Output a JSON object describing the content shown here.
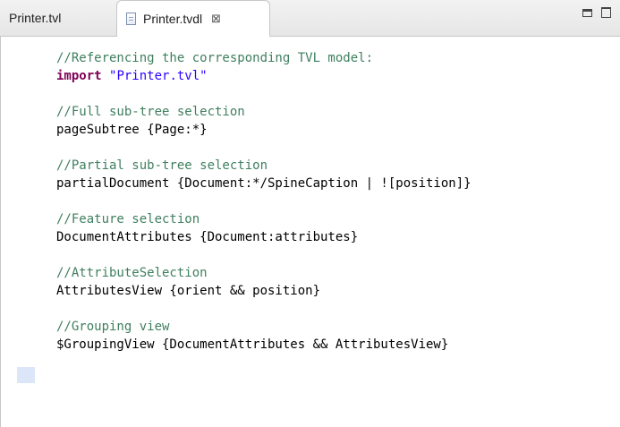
{
  "tabs": [
    {
      "label": "Printer.tvl",
      "active": false
    },
    {
      "label": "Printer.tvdl",
      "active": true,
      "icon": "file-icon",
      "close_glyph": "⊠"
    }
  ],
  "window_controls": {
    "minimize": "minimize-icon",
    "maximize": "maximize-icon"
  },
  "code_lines": [
    {
      "comment": "//Referencing the corresponding TVL model:"
    },
    {
      "keyword": "import",
      "string": "\"Printer.tvl\""
    },
    {
      "blank": true
    },
    {
      "comment": "//Full sub-tree selection"
    },
    {
      "plain": "pageSubtree {Page:*}"
    },
    {
      "blank": true
    },
    {
      "comment": "//Partial sub-tree selection"
    },
    {
      "plain": "partialDocument {Document:*/SpineCaption | ![position]}"
    },
    {
      "blank": true
    },
    {
      "comment": "//Feature selection"
    },
    {
      "plain": "DocumentAttributes {Document:attributes}"
    },
    {
      "blank": true
    },
    {
      "comment": "//AttributeSelection"
    },
    {
      "plain": "AttributesView {orient && position}"
    },
    {
      "blank": true
    },
    {
      "comment": "//Grouping view"
    },
    {
      "plain": "$GroupingView {DocumentAttributes && AttributesView}"
    }
  ],
  "colors": {
    "comment": "#3f7f5f",
    "keyword": "#7f0055",
    "string": "#2a00ff",
    "highlight": "#dbe6f8"
  }
}
